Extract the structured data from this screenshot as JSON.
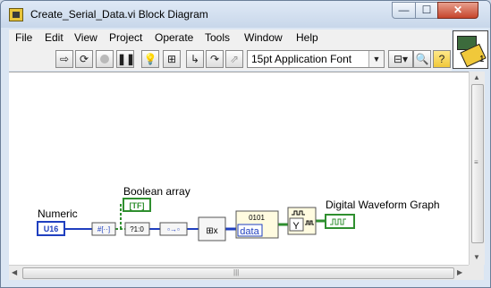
{
  "window": {
    "title": "Create_Serial_Data.vi Block Diagram"
  },
  "window_controls": {
    "minimize": "—",
    "maximize": "☐",
    "close": "✕"
  },
  "menu": {
    "items": [
      "File",
      "Edit",
      "View",
      "Project",
      "Operate",
      "Tools",
      "Window",
      "Help"
    ]
  },
  "toolbar": {
    "buttons": [
      "run-arrow",
      "run-continuously",
      "abort",
      "pause",
      "highlight-execution",
      "retain-wire-values",
      "step-into",
      "step-over",
      "step-out"
    ],
    "font_selector": "15pt Application Font",
    "align_button": "align-objects",
    "search_button": "search",
    "help_button": "?"
  },
  "vi_icon": {
    "label": "1"
  },
  "diagram": {
    "labels": {
      "numeric": "Numeric",
      "boolean_array": "Boolean array",
      "digital_waveform_graph": "Digital Waveform Graph"
    },
    "terminals": {
      "numeric": "U16",
      "boolean_array": "[TF]",
      "data": "data",
      "y": "Y",
      "binary": "0101"
    },
    "colors": {
      "integer_wire": "#1f3fbf",
      "boolean_wire": "#2f8f2f",
      "waveform_wire": "#2f8f2f"
    }
  }
}
